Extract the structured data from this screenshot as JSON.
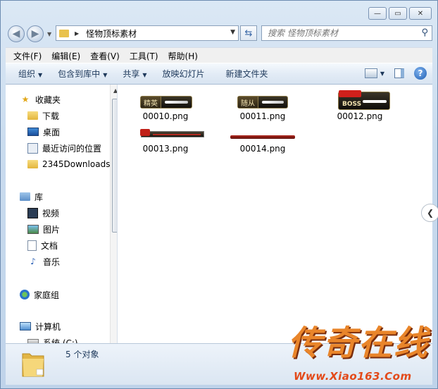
{
  "window": {
    "caption_buttons": [
      "minimize",
      "maximize",
      "close"
    ]
  },
  "address_bar": {
    "path": "怪物顶标素材"
  },
  "search": {
    "placeholder": "搜索 怪物顶标素材"
  },
  "menu": [
    "文件(F)",
    "编辑(E)",
    "查看(V)",
    "工具(T)",
    "帮助(H)"
  ],
  "toolbar": {
    "organize": "组织",
    "include_in_library": "包含到库中",
    "share": "共享",
    "slideshow": "放映幻灯片",
    "new_folder": "新建文件夹"
  },
  "nav_pane": {
    "favorites": "收藏夹",
    "downloads": "下载",
    "desktop": "桌面",
    "recent": "最近访问的位置",
    "folder_2345": "2345Downloads",
    "libraries": "库",
    "videos": "视频",
    "pictures": "图片",
    "documents": "文档",
    "music": "音乐",
    "homegroup": "家庭组",
    "computer": "计算机",
    "drive_c": "系统 (C:)"
  },
  "files": [
    {
      "name": "00010.png",
      "tag": "精英"
    },
    {
      "name": "00011.png",
      "tag": "随从"
    },
    {
      "name": "00012.png",
      "tag": "BOSS"
    },
    {
      "name": "00013.png",
      "tag": ""
    },
    {
      "name": "00014.png",
      "tag": ""
    }
  ],
  "status": {
    "count": "5 个对象"
  },
  "watermark": {
    "title": "传奇在线",
    "url": "Www.Xiao163.Com"
  },
  "colors": {
    "chrome": "#c9dbee",
    "toolbar_text": "#1e395b",
    "watermark": "#e9852a"
  }
}
